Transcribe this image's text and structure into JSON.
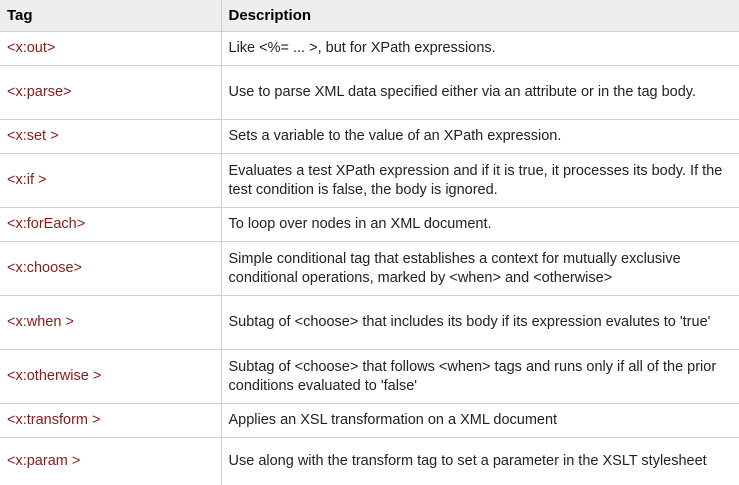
{
  "table": {
    "headers": {
      "tag": "Tag",
      "description": "Description"
    },
    "rows": [
      {
        "tag": "<x:out>",
        "description": "Like <%= ... >, but for XPath expressions."
      },
      {
        "tag": "<x:parse>",
        "description": "Use to parse XML data specified either via an attribute or in the tag body."
      },
      {
        "tag": "<x:set >",
        "description": "Sets a variable to the value of an XPath expression."
      },
      {
        "tag": "<x:if >",
        "description": "Evaluates a test XPath expression and if it is true, it processes its body. If the test condition is false, the body is ignored."
      },
      {
        "tag": "<x:forEach>",
        "description": "To loop over nodes in an XML document."
      },
      {
        "tag": "<x:choose>",
        "description": "Simple conditional tag that establishes a context for mutually exclusive conditional operations, marked by <when> and <otherwise>"
      },
      {
        "tag": "<x:when >",
        "description": "Subtag of <choose> that includes its body if its expression evalutes to 'true'"
      },
      {
        "tag": "<x:otherwise >",
        "description": "Subtag of <choose> that follows <when> tags and runs only if all of the prior conditions evaluated to 'false'"
      },
      {
        "tag": "<x:transform >",
        "description": "Applies an XSL transformation on a XML document"
      },
      {
        "tag": "<x:param >",
        "description": "Use along with the transform tag to set a parameter in the XSLT stylesheet"
      }
    ]
  },
  "colors": {
    "header_bg": "#eeeeee",
    "tag_text": "#8b1a1a",
    "border": "#cfcfcf"
  }
}
